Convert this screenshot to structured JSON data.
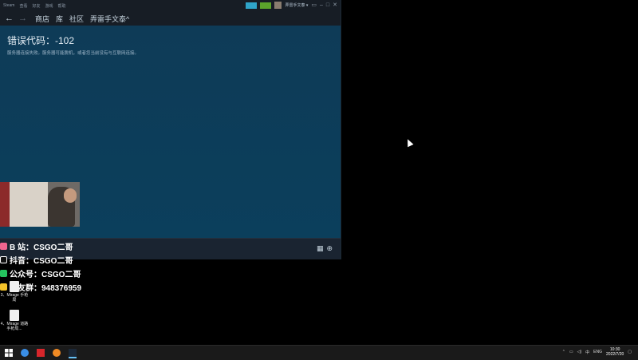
{
  "window": {
    "menu": [
      "Steam",
      "查看",
      "好友",
      "游戏",
      "帮助"
    ],
    "username": "弄雷手文泰 ▾",
    "nav": {
      "back": "←",
      "forward": "→",
      "links": [
        "商店",
        "库",
        "社区",
        "弄雷手文泰^"
      ]
    },
    "controls": {
      "minimize": "–",
      "maximize": "□",
      "close": "✕"
    }
  },
  "content": {
    "error_title": "错误代码：-102",
    "error_message": "服务器连接失败。服务器可能脱机，或者您当前没有与互联网连接。"
  },
  "overlay": {
    "lines": [
      {
        "text": "B 站：CSGO二哥",
        "icon_color": "#f0658f",
        "icon": "bilibili-icon"
      },
      {
        "text": "抖音：CSGO二哥",
        "icon_color": "#111111",
        "icon": "tiktok-icon"
      },
      {
        "text": "公众号：CSGO二哥",
        "icon_color": "#24c35e",
        "icon": "wechat-icon"
      },
      {
        "text": "水友群：948376959",
        "icon_color": "#f3c229",
        "icon": "qq-icon"
      }
    ]
  },
  "desktop": {
    "icons": [
      {
        "label": "3、Mirage 手枪局"
      },
      {
        "label": "4、Mirage 道路手枪局..."
      }
    ]
  },
  "taskbar": {
    "tray_lang": "ENG",
    "tray_ime": "中",
    "time": "10:30",
    "date": "2022/7/20"
  }
}
